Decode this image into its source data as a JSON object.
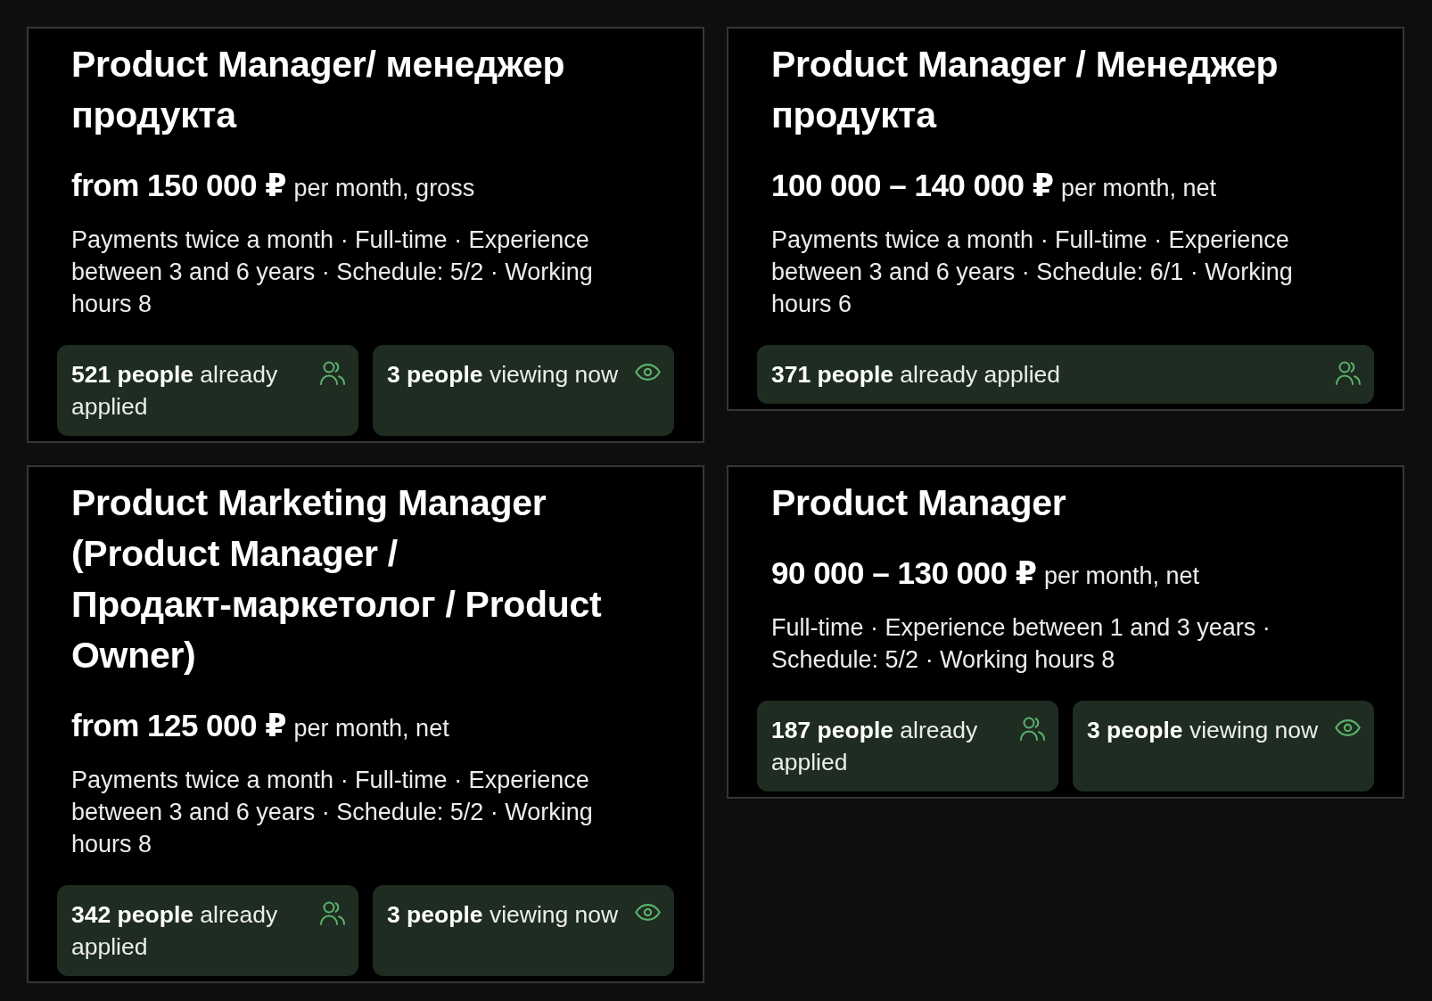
{
  "vacancies": [
    {
      "title": "Product Manager/ менеджер продукта",
      "salary": {
        "amount": "from 150 000 ₽",
        "period": "per month, gross"
      },
      "details": "Payments twice a month · Full-time · Experience between 3 and 6 years · Schedule: 5/2 · Working hours 8",
      "stats": [
        {
          "kind": "applied",
          "text": "**521 people** already applied"
        },
        {
          "kind": "viewing",
          "text": "**3 people** viewing now"
        }
      ]
    },
    {
      "title": "Product Manager / Менеджер продукта",
      "salary": {
        "amount": "100 000 – 140 000 ₽",
        "period": "per month, net"
      },
      "details": "Payments twice a month · Full-time · Experience between 3 and 6 years · Schedule: 6/1 · Working hours 6",
      "stats": [
        {
          "kind": "applied",
          "text": "**371 people** already applied"
        }
      ]
    },
    {
      "title": "Product Marketing Manager (Product Manager / Продакт-маркетолог / Product Owner)",
      "salary": {
        "amount": "from 125 000 ₽",
        "period": "per month, net"
      },
      "details": "Payments twice a month · Full-time · Experience between 3 and 6 years · Schedule: 5/2 · Working hours 8",
      "stats": [
        {
          "kind": "applied",
          "text": "**342 people** already applied"
        },
        {
          "kind": "viewing",
          "text": "**3 people** viewing now"
        }
      ]
    },
    {
      "title": "Product Manager",
      "salary": {
        "amount": "90 000 – 130 000 ₽",
        "period": "per month, net"
      },
      "details": "Full-time · Experience between 1 and 3 years · Schedule: 5/2 · Working hours 8",
      "stats": [
        {
          "kind": "applied",
          "text": "**187 people** already applied"
        },
        {
          "kind": "viewing",
          "text": "**3 people** viewing now"
        }
      ]
    }
  ]
}
